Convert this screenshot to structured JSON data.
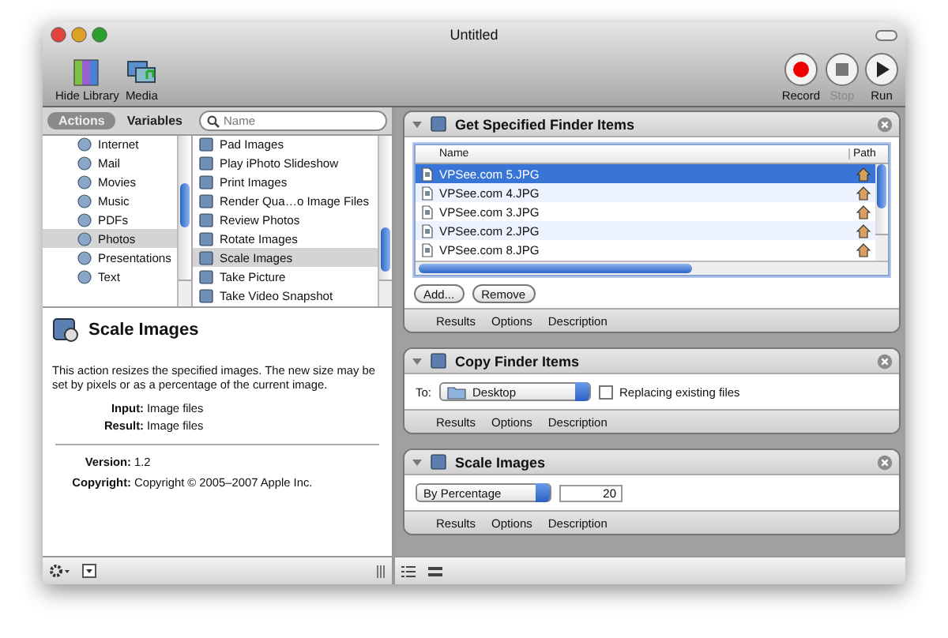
{
  "window": {
    "title": "Untitled"
  },
  "toolbar": {
    "left": [
      {
        "label": "Hide Library",
        "kind": "library"
      },
      {
        "label": "Media",
        "kind": "media"
      }
    ],
    "right": [
      {
        "label": "Record",
        "kind": "record",
        "disabled": false
      },
      {
        "label": "Stop",
        "kind": "stop",
        "disabled": true
      },
      {
        "label": "Run",
        "kind": "run",
        "disabled": false
      }
    ]
  },
  "library": {
    "tabs": [
      {
        "label": "Actions",
        "selected": true
      },
      {
        "label": "Variables",
        "selected": false
      }
    ],
    "search": {
      "placeholder": "Name"
    },
    "categories": [
      {
        "label": "Internet",
        "selected": false
      },
      {
        "label": "Mail",
        "selected": false
      },
      {
        "label": "Movies",
        "selected": false
      },
      {
        "label": "Music",
        "selected": false
      },
      {
        "label": "PDFs",
        "selected": false
      },
      {
        "label": "Photos",
        "selected": true
      },
      {
        "label": "Presentations",
        "selected": false
      },
      {
        "label": "Text",
        "selected": false
      }
    ],
    "actions": [
      {
        "label": "Pad Images",
        "selected": false
      },
      {
        "label": "Play iPhoto Slideshow",
        "selected": false
      },
      {
        "label": "Print Images",
        "selected": false
      },
      {
        "label": "Render Qua…o Image Files",
        "selected": false
      },
      {
        "label": "Review Photos",
        "selected": false
      },
      {
        "label": "Rotate Images",
        "selected": false
      },
      {
        "label": "Scale Images",
        "selected": true
      },
      {
        "label": "Take Picture",
        "selected": false
      },
      {
        "label": "Take Video Snapshot",
        "selected": false
      }
    ]
  },
  "description": {
    "title": "Scale Images",
    "text": "This action resizes the specified images. The new size may be set by pixels or as a percentage of the current image.",
    "fields": [
      {
        "label": "Input:",
        "value": "Image files"
      },
      {
        "label": "Result:",
        "value": "Image files"
      }
    ],
    "meta": [
      {
        "label": "Version:",
        "value": "1.2"
      },
      {
        "label": "Copyright:",
        "value": "Copyright © 2005–2007 Apple Inc."
      }
    ]
  },
  "workflow": [
    {
      "kind": "items",
      "title": "Get Specified Finder Items",
      "expanded": true,
      "columns": [
        "Name",
        "Path"
      ],
      "rows": [
        {
          "name": "VPSee.com 5.JPG",
          "selected": true
        },
        {
          "name": "VPSee.com 4.JPG",
          "selected": false
        },
        {
          "name": "VPSee.com 3.JPG",
          "selected": false
        },
        {
          "name": "VPSee.com 2.JPG",
          "selected": false
        },
        {
          "name": "VPSee.com 8.JPG",
          "selected": false
        }
      ],
      "buttons": [
        "Add...",
        "Remove"
      ],
      "tabs": [
        "Results",
        "Options",
        "Description"
      ]
    },
    {
      "kind": "copy",
      "title": "Copy Finder Items",
      "expanded": true,
      "to_label": "To:",
      "destination": "Desktop",
      "replace": {
        "label": "Replacing existing files",
        "checked": false
      },
      "tabs": [
        "Results",
        "Options",
        "Description"
      ]
    },
    {
      "kind": "scale",
      "title": "Scale Images",
      "expanded": true,
      "mode": "By Percentage",
      "value": "20",
      "tabs": [
        "Results",
        "Options",
        "Description"
      ]
    }
  ]
}
